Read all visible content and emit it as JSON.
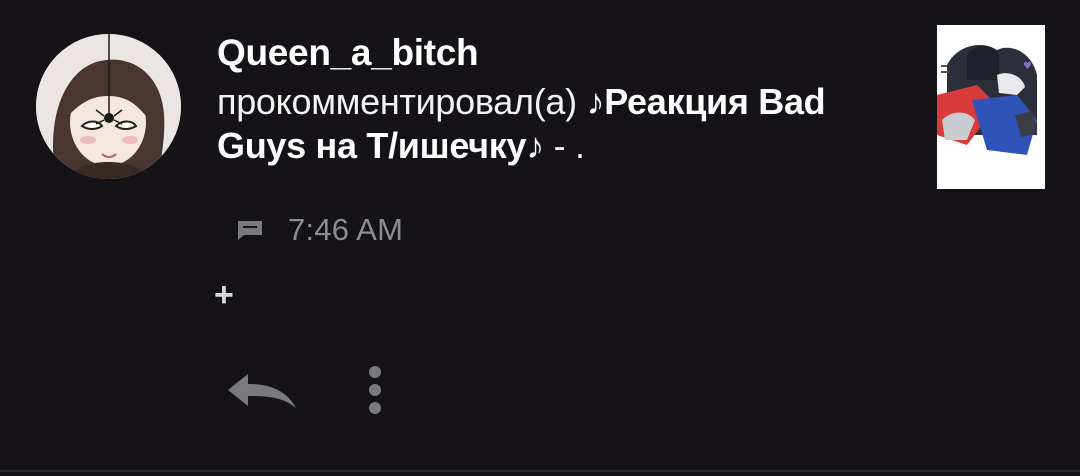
{
  "notification": {
    "username": "Queen_a_bitch",
    "action_text": "прокомментировал(а) ",
    "post_title": "♪Реакция Bad Guys на Т/ишечку♪",
    "comment_text": " - .",
    "time": "7:46 AM",
    "extra_indicator": "+"
  },
  "icons": {
    "comment": "comment-icon",
    "reply": "reply-arrow-icon",
    "more": "more-vertical-icon"
  },
  "colors": {
    "background": "#151317",
    "text_primary": "#ffffff",
    "text_secondary": "#8d8c91",
    "icon_muted": "#7a797e",
    "divider": "#2b2a2e"
  }
}
